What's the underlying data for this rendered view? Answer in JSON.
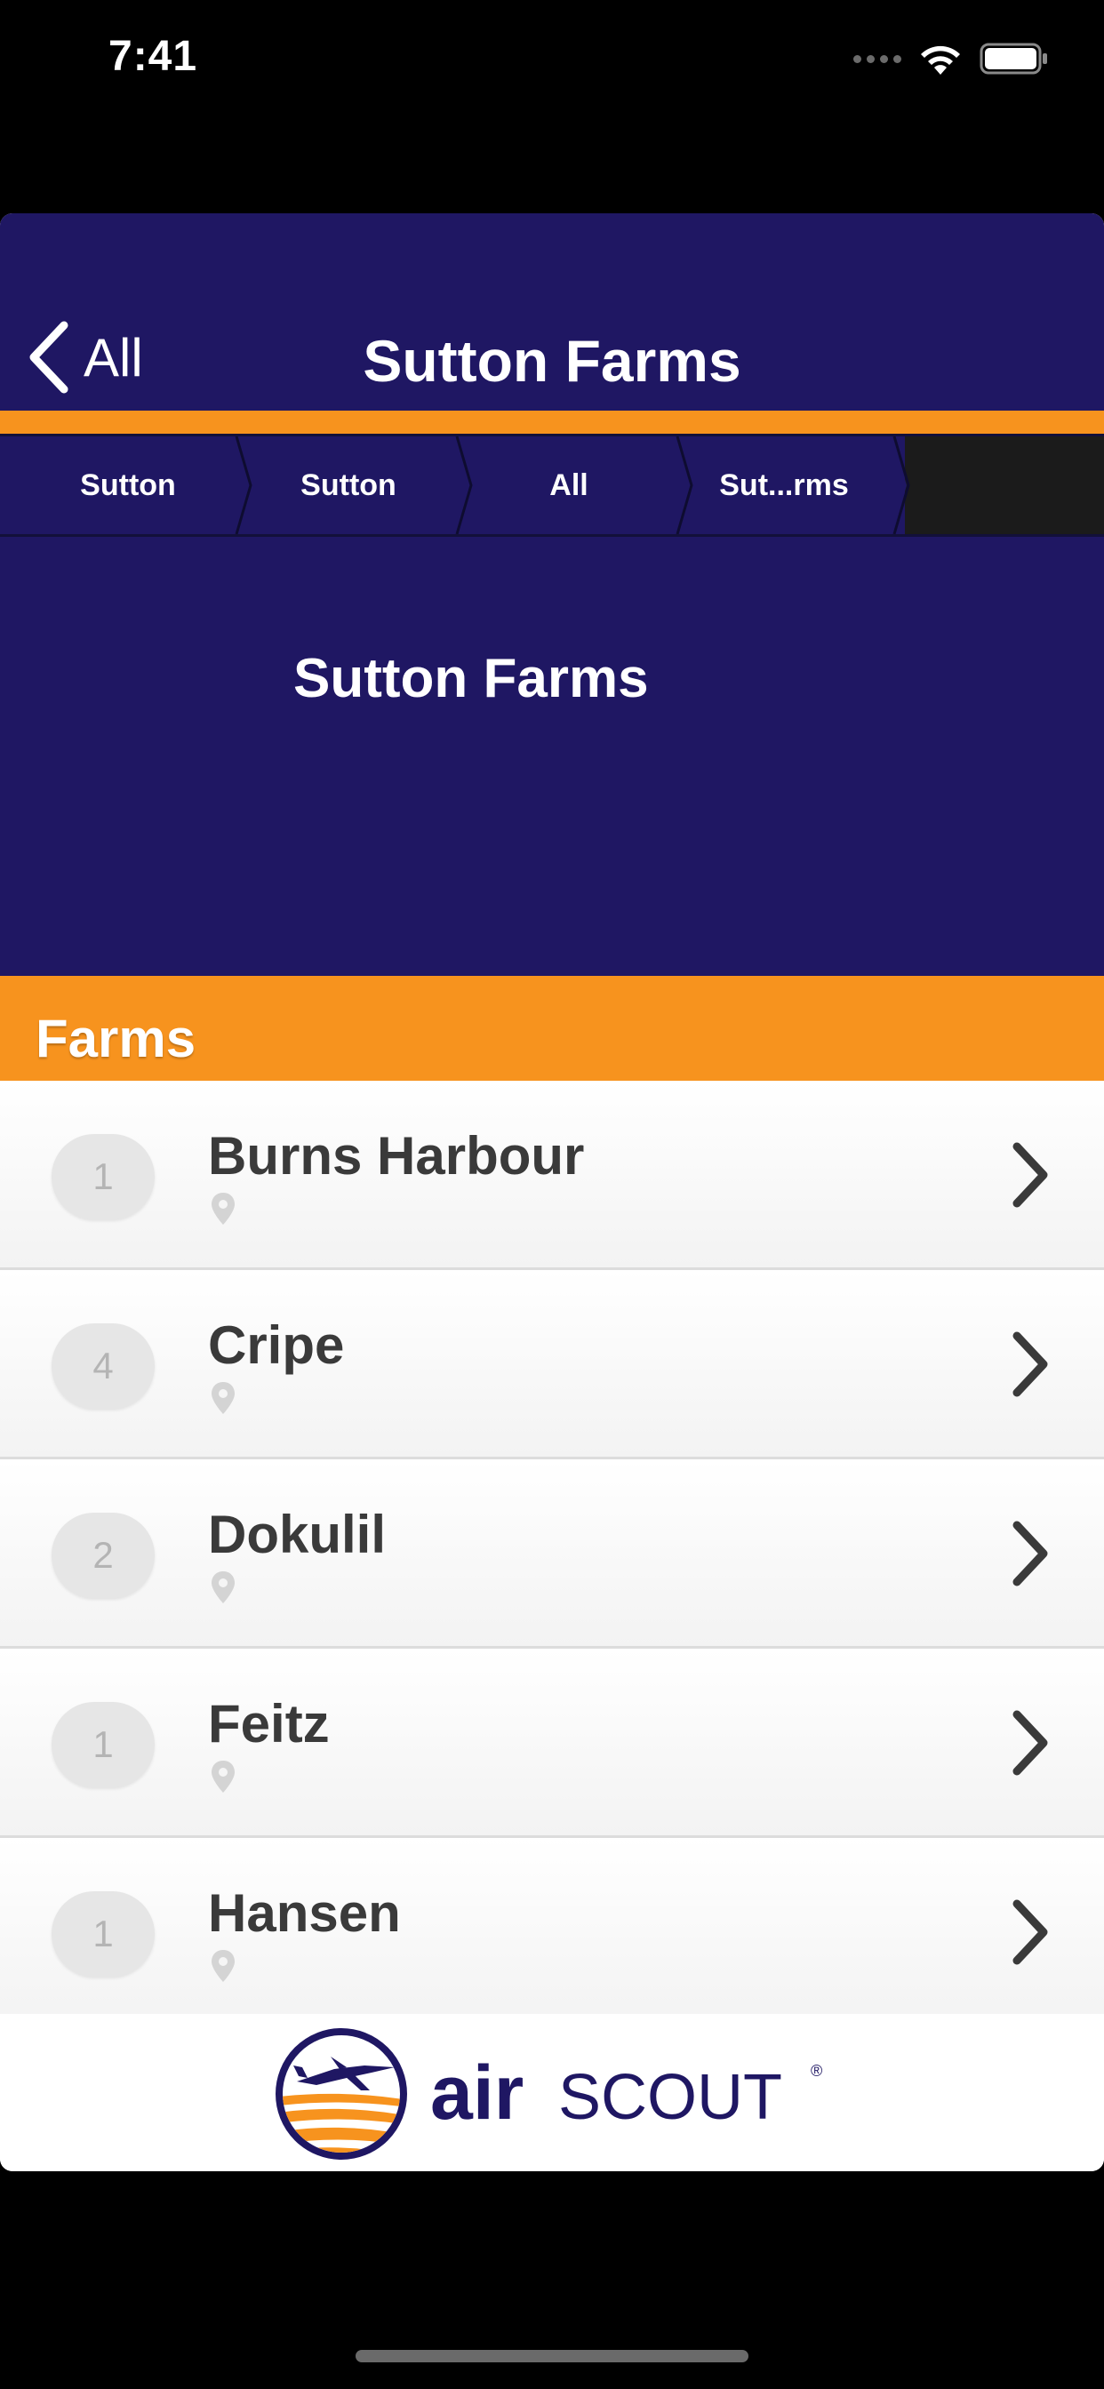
{
  "status_bar": {
    "time": "7:41"
  },
  "nav": {
    "back_label": "All",
    "title": "Sutton Farms"
  },
  "breadcrumb": {
    "items": [
      {
        "label": "Sutton"
      },
      {
        "label": "Sutton"
      },
      {
        "label": "All"
      },
      {
        "label": "Sut...rms"
      }
    ]
  },
  "hero": {
    "title": "Sutton Farms"
  },
  "section": {
    "title": "Farms"
  },
  "farms": [
    {
      "count": "1",
      "name": "Burns Harbour"
    },
    {
      "count": "4",
      "name": "Cripe"
    },
    {
      "count": "2",
      "name": "Dokulil"
    },
    {
      "count": "1",
      "name": "Feitz"
    },
    {
      "count": "1",
      "name": "Hansen"
    }
  ],
  "footer": {
    "logo_word_1": "air",
    "logo_word_2": "SCOUT",
    "logo_mark": "®"
  },
  "colors": {
    "navy": "#1f1763",
    "orange": "#f7931e"
  },
  "icons": {
    "back": "chevron-left-icon",
    "row_arrow": "chevron-right-icon",
    "location": "map-pin-icon",
    "wifi": "wifi-icon",
    "battery": "battery-icon"
  }
}
